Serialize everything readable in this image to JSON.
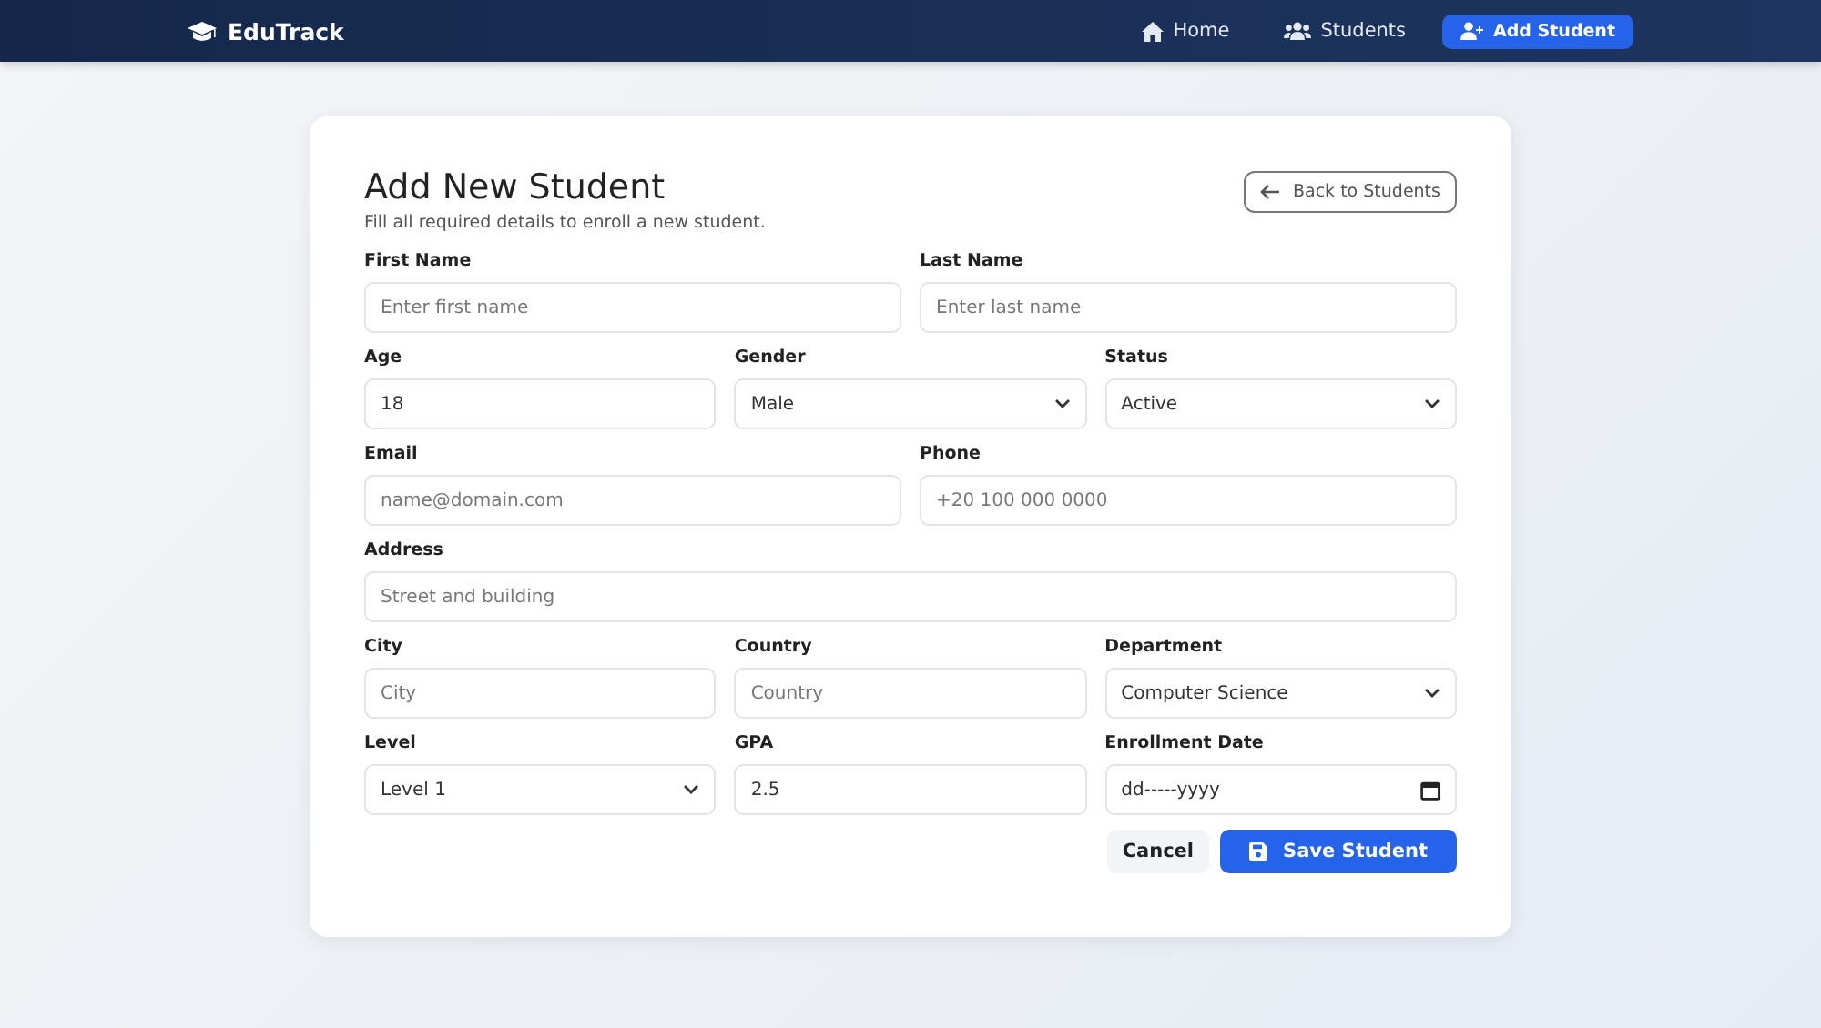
{
  "brand": "EduTrack",
  "nav": [
    {
      "label": "Home",
      "selected": false
    },
    {
      "label": "Students",
      "selected": false
    },
    {
      "label": "Add Student",
      "selected": true
    }
  ],
  "form": {
    "title": "Add New Student",
    "subtitle": "Fill all required details to enroll a new student.",
    "back_button": "Back to Students",
    "rows": [
      [
        {
          "label": "First Name",
          "kind": "text",
          "placeholder": "Enter first name"
        },
        {
          "label": "Last Name",
          "kind": "text",
          "placeholder": "Enter last name"
        }
      ],
      [
        {
          "label": "Age",
          "kind": "text",
          "value": "18"
        },
        {
          "label": "Gender",
          "kind": "select",
          "value": "Male"
        },
        {
          "label": "Status",
          "kind": "select",
          "value": "Active"
        }
      ],
      [
        {
          "label": "Email",
          "kind": "text",
          "placeholder": "name@domain.com"
        },
        {
          "label": "Phone",
          "kind": "text",
          "placeholder": "+20 100 000 0000"
        }
      ],
      [
        {
          "label": "Address",
          "kind": "text",
          "placeholder": "Street and building"
        }
      ],
      [
        {
          "label": "City",
          "kind": "text",
          "placeholder": "City"
        },
        {
          "label": "Country",
          "kind": "text",
          "placeholder": "Country"
        },
        {
          "label": "Department",
          "kind": "select",
          "value": "Computer Science"
        }
      ],
      [
        {
          "label": "Level",
          "kind": "select",
          "value": "Level 1"
        },
        {
          "label": "GPA",
          "kind": "text",
          "value": "2.5"
        },
        {
          "label": "Enrollment Date",
          "kind": "date",
          "value": "dd-----yyyy"
        }
      ]
    ],
    "cancel_button": "Cancel",
    "save_button": "Save Student"
  }
}
